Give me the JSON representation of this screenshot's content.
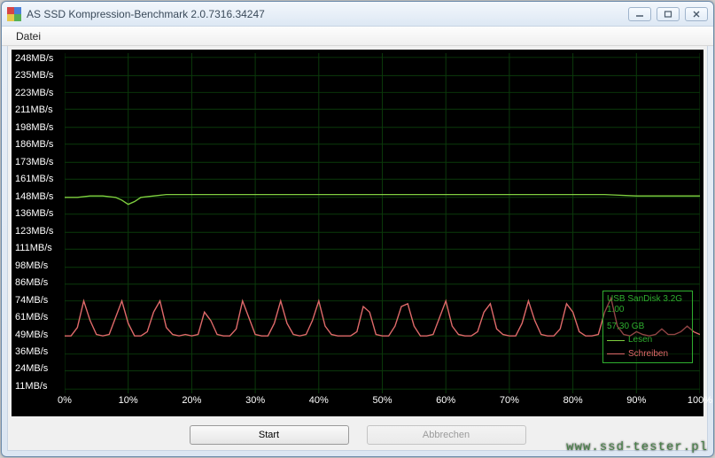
{
  "window": {
    "title": "AS SSD Kompression-Benchmark 2.0.7316.34247"
  },
  "menu": {
    "file": "Datei"
  },
  "buttons": {
    "start": "Start",
    "cancel": "Abbrechen"
  },
  "info": {
    "device": "USB  SanDisk 3.2G",
    "firmware": "1.00",
    "capacity": "57,30 GB",
    "read_label": "Lesen",
    "write_label": "Schreiben"
  },
  "watermark": "www.ssd-tester.pl",
  "chart_data": {
    "type": "line",
    "xlabel": "",
    "ylabel": "",
    "xlim": [
      0,
      100
    ],
    "ylim": [
      0,
      255
    ],
    "x_ticks": [
      "0%",
      "10%",
      "20%",
      "30%",
      "40%",
      "50%",
      "60%",
      "70%",
      "80%",
      "90%",
      "100%"
    ],
    "y_ticks": [
      "248MB/s",
      "235MB/s",
      "223MB/s",
      "211MB/s",
      "198MB/s",
      "186MB/s",
      "173MB/s",
      "161MB/s",
      "148MB/s",
      "136MB/s",
      "123MB/s",
      "111MB/s",
      "98MB/s",
      "86MB/s",
      "74MB/s",
      "61MB/s",
      "49MB/s",
      "36MB/s",
      "24MB/s",
      "11MB/s"
    ],
    "series": [
      {
        "name": "Lesen",
        "color": "#7fcf3f",
        "x": [
          0,
          2,
          4,
          6,
          8,
          9,
          10,
          11,
          12,
          14,
          16,
          18,
          20,
          25,
          30,
          35,
          40,
          45,
          50,
          55,
          60,
          65,
          70,
          75,
          80,
          85,
          90,
          95,
          100
        ],
        "y": [
          148,
          148,
          149,
          149,
          148,
          146,
          143,
          145,
          148,
          149,
          150,
          150,
          150,
          150,
          150,
          150,
          150,
          150,
          150,
          150,
          150,
          150,
          150,
          150,
          150,
          150,
          149,
          149,
          149
        ]
      },
      {
        "name": "Schreiben",
        "color": "#e06a6a",
        "x": [
          0,
          1,
          2,
          3,
          4,
          5,
          6,
          7,
          8,
          9,
          10,
          11,
          12,
          13,
          14,
          15,
          16,
          17,
          18,
          19,
          20,
          21,
          22,
          23,
          24,
          25,
          26,
          27,
          28,
          29,
          30,
          31,
          32,
          33,
          34,
          35,
          36,
          37,
          38,
          39,
          40,
          41,
          42,
          43,
          44,
          45,
          46,
          47,
          48,
          49,
          50,
          51,
          52,
          53,
          54,
          55,
          56,
          57,
          58,
          59,
          60,
          61,
          62,
          63,
          64,
          65,
          66,
          67,
          68,
          69,
          70,
          71,
          72,
          73,
          74,
          75,
          76,
          77,
          78,
          79,
          80,
          81,
          82,
          83,
          84,
          85,
          86,
          87,
          88,
          89,
          90,
          91,
          92,
          93,
          94,
          95,
          96,
          97,
          98,
          99,
          100
        ],
        "y": [
          49,
          49,
          55,
          74,
          60,
          50,
          49,
          50,
          62,
          74,
          58,
          49,
          49,
          52,
          66,
          74,
          55,
          50,
          49,
          50,
          49,
          50,
          66,
          60,
          50,
          49,
          49,
          54,
          74,
          62,
          50,
          49,
          49,
          58,
          74,
          58,
          50,
          49,
          50,
          60,
          74,
          56,
          50,
          49,
          49,
          49,
          52,
          70,
          66,
          50,
          49,
          49,
          56,
          70,
          72,
          56,
          49,
          49,
          50,
          62,
          74,
          56,
          50,
          49,
          49,
          52,
          66,
          72,
          54,
          50,
          49,
          49,
          58,
          74,
          60,
          50,
          49,
          49,
          54,
          72,
          66,
          52,
          49,
          49,
          50,
          66,
          76,
          56,
          50,
          49,
          52,
          50,
          49,
          50,
          54,
          50,
          50,
          52,
          56,
          52,
          50
        ]
      }
    ]
  }
}
